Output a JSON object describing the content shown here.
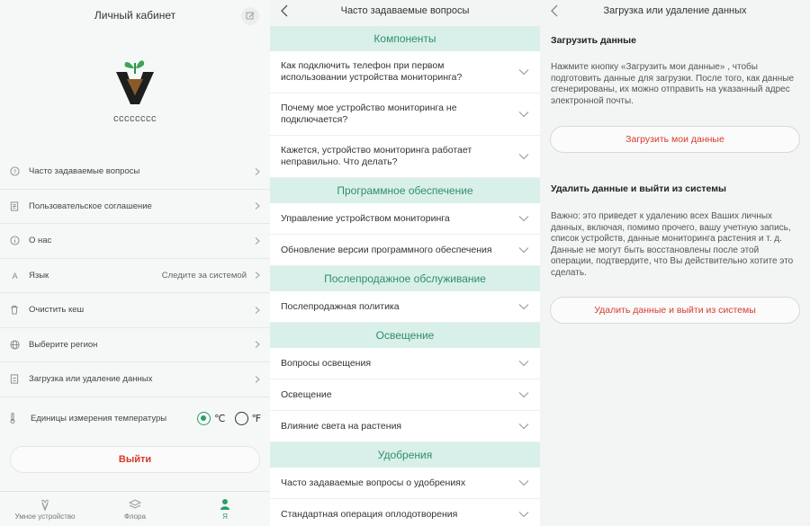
{
  "profile": {
    "title": "Личный кабинет",
    "username": "cccccccc",
    "menu": [
      {
        "label": "Часто задаваемые вопросы",
        "value": "",
        "icon": "question-icon"
      },
      {
        "label": "Пользовательское соглашение",
        "value": "",
        "icon": "document-icon"
      },
      {
        "label": "О нас",
        "value": "",
        "icon": "info-icon"
      },
      {
        "label": "Язык",
        "value": "Следите за системой",
        "icon": "language-icon"
      },
      {
        "label": "Очистить кеш",
        "value": "",
        "icon": "trash-icon"
      },
      {
        "label": "Выберите регион",
        "value": "",
        "icon": "globe-icon"
      },
      {
        "label": "Загрузка или удаление данных",
        "value": "",
        "icon": "data-icon"
      }
    ],
    "temperature": {
      "label": "Единицы измерения температуры",
      "celsius": "℃",
      "fahrenheit": "℉",
      "selected": "celsius"
    },
    "logout_label": "Выйти",
    "nav": [
      {
        "label": "Умное устройство",
        "icon": "plant-device-icon",
        "active": false
      },
      {
        "label": "Флора",
        "icon": "layers-icon",
        "active": false
      },
      {
        "label": "Я",
        "icon": "person-icon",
        "active": true
      }
    ]
  },
  "faq": {
    "title": "Часто задаваемые вопросы",
    "sections": [
      {
        "title": "Компоненты",
        "items": [
          "Как подключить телефон при первом использовании устройства мониторинга?",
          "Почему мое устройство мониторинга не подключается?",
          "Кажется, устройство мониторинга работает неправильно. Что делать?"
        ]
      },
      {
        "title": "Программное обеспечение",
        "items": [
          "Управление устройством мониторинга",
          "Обновление версии программного обеспечения"
        ]
      },
      {
        "title": "Послепродажное обслуживание",
        "items": [
          "Послепродажная политика"
        ]
      },
      {
        "title": "Освещение",
        "items": [
          "Вопросы освещения",
          "Освещение",
          "Влияние света на растения"
        ]
      },
      {
        "title": "Удобрения",
        "items": [
          "Часто задаваемые вопросы о удобрениях",
          "Стандартная операция оплодотворения"
        ]
      }
    ]
  },
  "data_page": {
    "title": "Загрузка или удаление данных",
    "download_title": "Загрузить данные",
    "download_text": "Нажмите кнопку «Загрузить мои данные» , чтобы подготовить данные для загрузки. После того, как данные сгенерированы, их можно отправить на указанный адрес электронной почты.",
    "download_button": "Загрузить мои данные",
    "delete_title": "Удалить данные и выйти из системы",
    "delete_text": "Важно: это приведет к удалению всех Ваших личных данных, включая, помимо прочего, вашу учетную запись, список устройств, данные мониторинга растения и т. д. Данные не могут быть восстановлены после этой операции, подтвердите, что Вы действительно хотите это сделать.",
    "delete_button": "Удалить данные и выйти из системы"
  },
  "colors": {
    "accent": "#2a9d6a",
    "danger": "#d63a2c",
    "section_bg": "#d9efea"
  }
}
